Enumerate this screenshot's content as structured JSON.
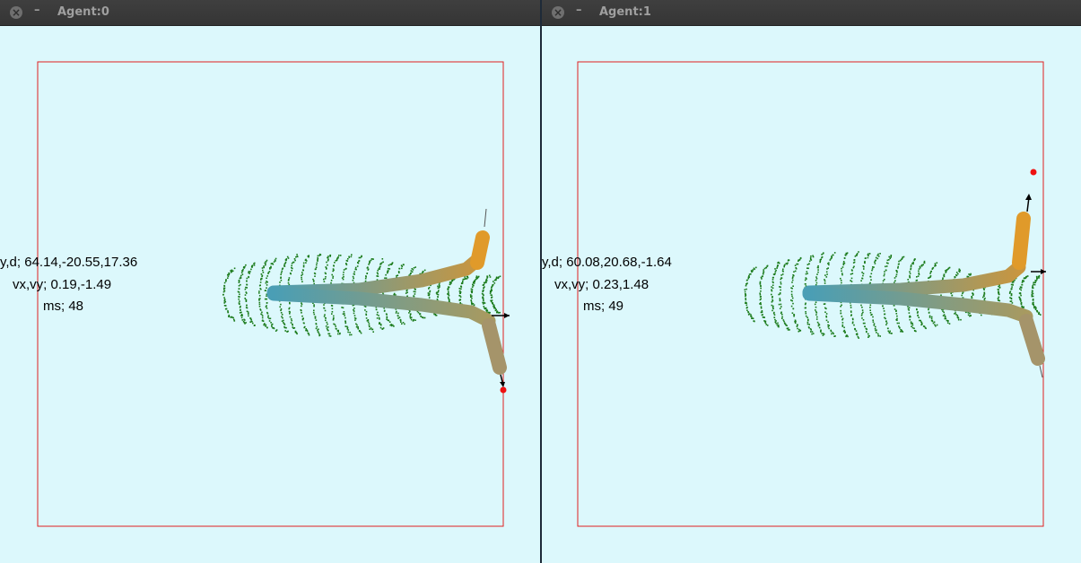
{
  "windows": [
    {
      "title": "Agent:0",
      "close_glyph": "×",
      "min_glyph": "–",
      "hud": {
        "pos": "y,d; 64.14,-20.55,17.36",
        "vel": "vx,vy; 0.19,-1.49",
        "ms": "ms; 48"
      }
    },
    {
      "title": "Agent:1",
      "close_glyph": "×",
      "min_glyph": "–",
      "hud": {
        "pos": "y,d; 60.08,20.68,-1.64",
        "vel": "vx,vy; 0.23,1.48",
        "ms": "ms; 49"
      }
    }
  ],
  "colors": {
    "background": "#dcf8fc",
    "arena_border": "#e02020",
    "trail_dots": "#1a7a1a",
    "target": "#ee1111",
    "body_blue": "#4a9eb5",
    "body_orange": "#e09a2a",
    "body_olive": "#9a9a6a"
  }
}
